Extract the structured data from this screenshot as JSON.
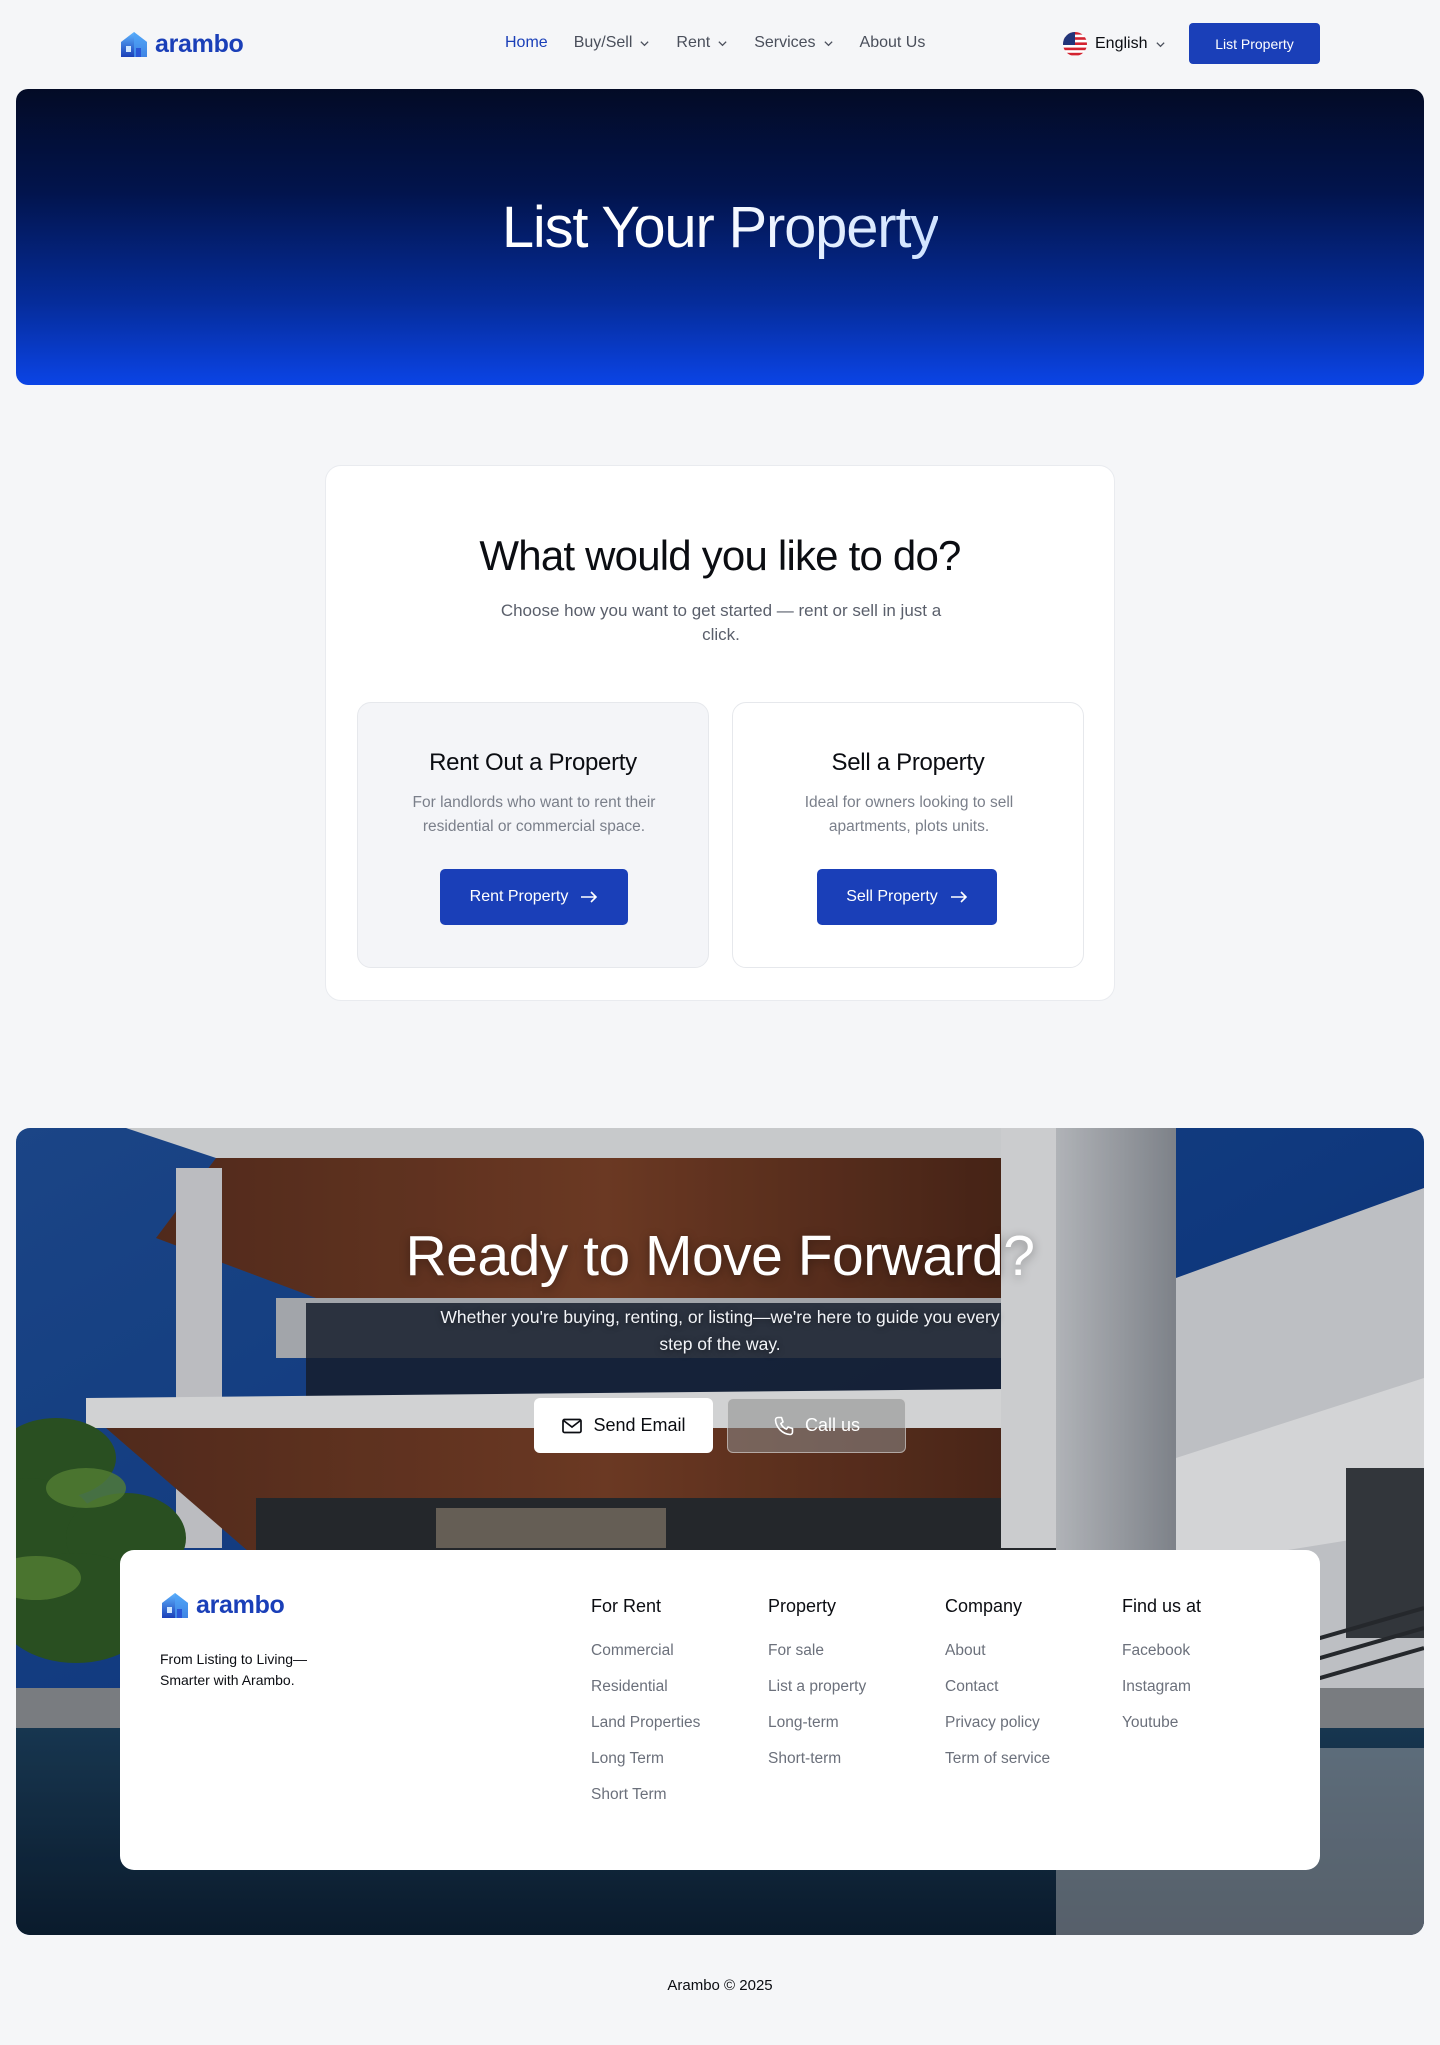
{
  "brand": {
    "name": "arambo",
    "color": "#1a3fb8"
  },
  "nav": {
    "links": [
      {
        "label": "Home",
        "active": true,
        "dropdown": false
      },
      {
        "label": "Buy/Sell",
        "active": false,
        "dropdown": true
      },
      {
        "label": "Rent",
        "active": false,
        "dropdown": true
      },
      {
        "label": "Services",
        "active": false,
        "dropdown": true
      },
      {
        "label": "About Us",
        "active": false,
        "dropdown": false
      }
    ],
    "language": "English",
    "language_icon": "us-flag-icon",
    "cta_label": "List Property"
  },
  "hero": {
    "title": "List Your Property"
  },
  "choice": {
    "title": "What would you like to do?",
    "subtitle": "Choose how you want to get started — rent or sell in just a click.",
    "options": [
      {
        "title": "Rent Out a Property",
        "description": "For landlords who want to rent their residential or commercial space.",
        "button": "Rent Property",
        "button_icon": "arrow-right-icon"
      },
      {
        "title": "Sell a Property",
        "description": "Ideal for owners looking to sell apartments, plots units.",
        "button": "Sell Property",
        "button_icon": "arrow-right-icon"
      }
    ]
  },
  "cta": {
    "title": "Ready to Move Forward?",
    "subtitle": "Whether you're buying, renting, or listing—we're here to guide you every step of the way.",
    "email_label": "Send Email",
    "email_icon": "mail-icon",
    "call_label": "Call us",
    "call_icon": "phone-icon"
  },
  "footer": {
    "tagline": "From Listing to Living—Smarter with Arambo.",
    "columns": [
      {
        "heading": "For Rent",
        "links": [
          "Commercial",
          "Residential",
          "Land Properties",
          "Long Term",
          "Short Term"
        ]
      },
      {
        "heading": "Property",
        "links": [
          "For sale",
          "List a property",
          "Long-term",
          "Short-term"
        ]
      },
      {
        "heading": "Company",
        "links": [
          "About",
          "Contact",
          "Privacy policy",
          "Term of service"
        ]
      },
      {
        "heading": "Find us at",
        "links": [
          "Facebook",
          "Instagram",
          "Youtube"
        ]
      }
    ],
    "copyright": "Arambo © 2025"
  }
}
